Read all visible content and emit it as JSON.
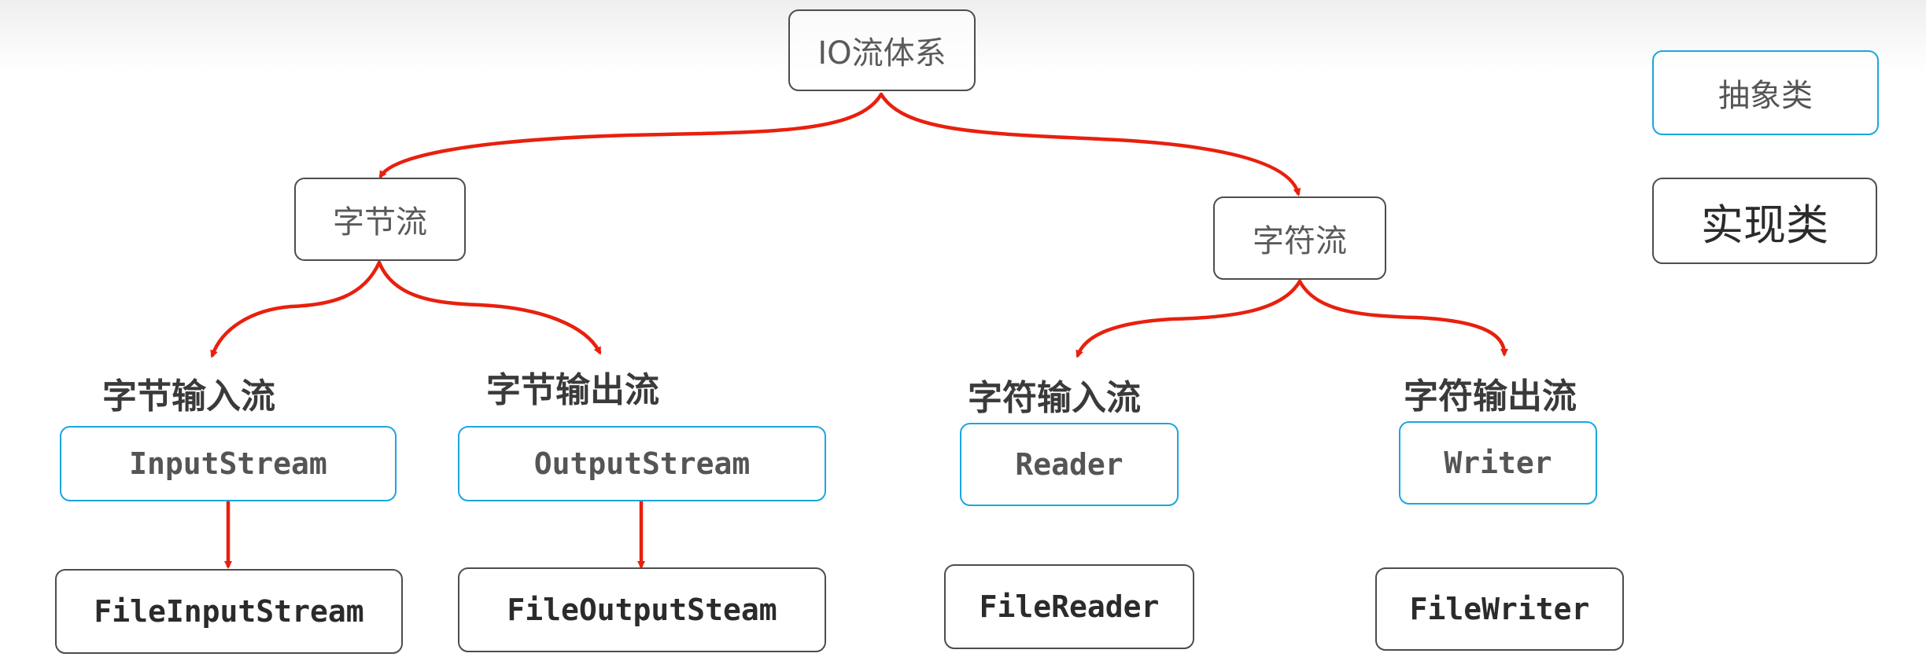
{
  "nodes": {
    "root": "IO流体系",
    "byte_stream": "字节流",
    "char_stream": "字符流",
    "input_stream": "InputStream",
    "output_stream": "OutputStream",
    "reader": "Reader",
    "writer": "Writer",
    "file_input_stream": "FileInputStream",
    "file_output_steam": "FileOutputSteam",
    "file_reader": "FileReader",
    "file_writer": "FileWriter"
  },
  "labels": {
    "byte_input": "字节输入流",
    "byte_output": "字节输出流",
    "char_input": "字符输入流",
    "char_output": "字符输出流"
  },
  "legend": {
    "abstract": "抽象类",
    "impl": "实现类"
  },
  "colors": {
    "arrow": "#e8200e",
    "abstract_border": "#1aa6e0",
    "impl_border": "#4d4d4d"
  }
}
